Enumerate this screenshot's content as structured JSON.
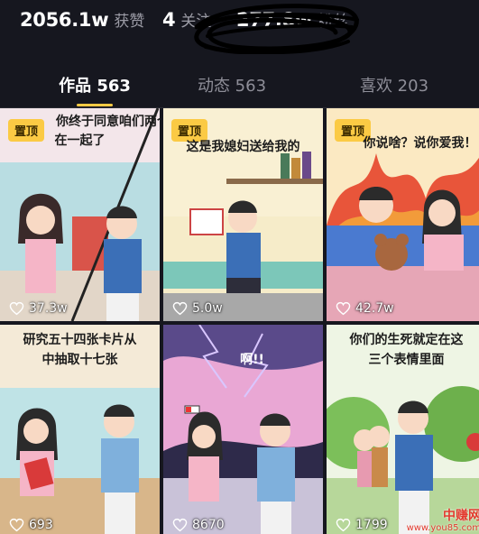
{
  "stats": {
    "likes": {
      "value": "2056.1w",
      "label": "获赞"
    },
    "following": {
      "value": "4",
      "label": "关注"
    },
    "followers": {
      "value": "277.8w",
      "label": "粉丝"
    }
  },
  "tabs": [
    {
      "label": "作品 563",
      "active": true
    },
    {
      "label": "动态 563",
      "active": false
    },
    {
      "label": "喜欢 203",
      "active": false
    }
  ],
  "accent_color": "#fbca44",
  "videos": [
    {
      "pinned": true,
      "pin_label": "置顶",
      "caption_line1": "你终于同意咱们两个",
      "caption_line2": "在一起了",
      "likes": "37.3w"
    },
    {
      "pinned": true,
      "pin_label": "置顶",
      "caption_line1": "这是我媳妇送给我的",
      "caption_line2": "",
      "likes": "5.0w"
    },
    {
      "pinned": true,
      "pin_label": "置顶",
      "caption_line1": "你说啥？说你爱我！",
      "caption_line2": "",
      "likes": "42.7w"
    },
    {
      "pinned": false,
      "pin_label": "",
      "caption_line1": "研究五十四张卡片从",
      "caption_line2": "中抽取十七张",
      "likes": "693"
    },
    {
      "pinned": false,
      "pin_label": "",
      "caption_line1": "啊!!",
      "caption_line2": "",
      "likes": "8670"
    },
    {
      "pinned": false,
      "pin_label": "",
      "caption_line1": "你们的生死就定在这",
      "caption_line2": "三个表情里面",
      "likes": "1799"
    }
  ],
  "watermark": {
    "brand": "中赚网",
    "url": "www.you85.com"
  },
  "icons": {
    "like": "heart-outline-icon",
    "pin": "pin-badge"
  }
}
